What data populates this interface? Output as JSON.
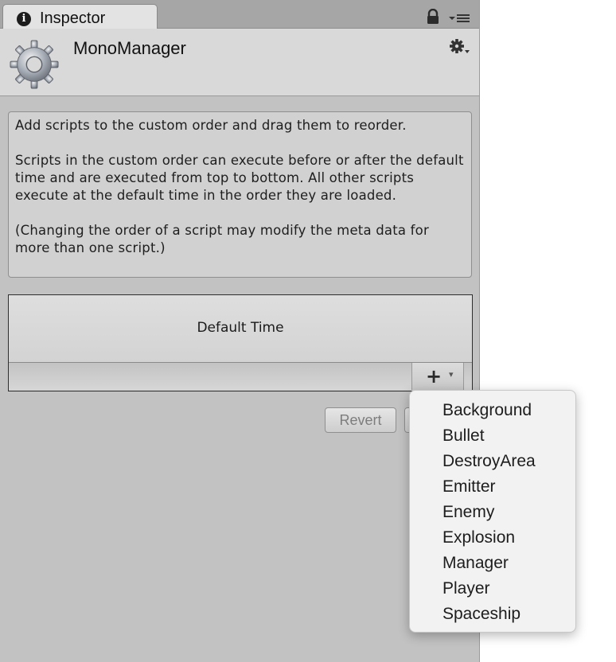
{
  "window": {
    "tab_title": "Inspector",
    "tab_icon": "info-icon",
    "tab_icon_glyph": "i"
  },
  "header": {
    "title": "MonoManager",
    "icon": "gear-icon"
  },
  "help": {
    "paragraph1": "Add scripts to the custom order and drag them to reorder.",
    "paragraph2": "Scripts in the custom order can execute before or after the default time and are executed from top to bottom. All other scripts execute at the default time in the order they are loaded.",
    "paragraph3": "(Changing the order of a script may modify the meta data for more than one script.)"
  },
  "order_list": {
    "default_time_label": "Default Time",
    "add_symbol": "+",
    "dropdown_symbol": "▾"
  },
  "buttons": {
    "revert": "Revert",
    "apply": ""
  },
  "menu": {
    "items": [
      "Background",
      "Bullet",
      "DestroyArea",
      "Emitter",
      "Enemy",
      "Explosion",
      "Manager",
      "Player",
      "Spaceship"
    ]
  },
  "colors": {
    "panel_bg": "#c2c2c2",
    "tab_bg": "#e3e3e3",
    "menu_bg": "#f2f2f2",
    "disabled_text": "#7d7d7d"
  }
}
